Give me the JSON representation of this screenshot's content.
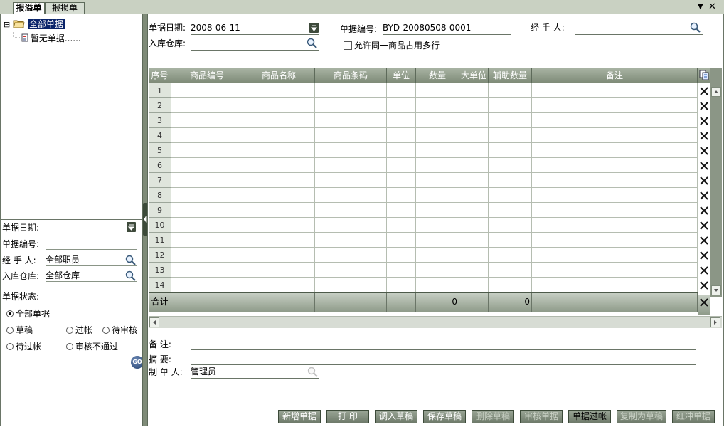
{
  "tabs": [
    {
      "label": "报溢单",
      "active": true
    },
    {
      "label": "报损单",
      "active": false
    }
  ],
  "window_controls": {
    "menu_glyph": "▼",
    "close_glyph": "✕"
  },
  "tree": {
    "collapse_glyph": "⊟",
    "root_label": "全部单据",
    "child_label": "暂无单据......"
  },
  "left_filter": {
    "date_label": "单据日期:",
    "date_value": "",
    "number_label": "单据编号:",
    "number_value": "",
    "handler_label": "经 手 人:",
    "handler_value": "全部职员",
    "warehouse_label": "入库仓库:",
    "warehouse_value": "全部仓库",
    "status_label": "单据状态:",
    "statuses": [
      {
        "label": "全部单据",
        "checked": true
      },
      {
        "label": "草稿",
        "checked": false
      },
      {
        "label": "过帐",
        "checked": false
      },
      {
        "label": "待审核",
        "checked": false
      },
      {
        "label": "待过帐",
        "checked": false
      },
      {
        "label": "审核不通过",
        "checked": false
      }
    ],
    "go_label": "GO"
  },
  "header_form": {
    "date_label": "单据日期:",
    "date_value": "2008-06-11",
    "number_label": "单据编号:",
    "number_value": "BYD-20080508-0001",
    "handler_label": "经 手 人:",
    "handler_value": "",
    "warehouse_label": "入库仓库:",
    "warehouse_value": "",
    "allow_multi_label": "允许同一商品占用多行",
    "allow_multi_checked": false
  },
  "grid": {
    "columns": [
      "序号",
      "商品编号",
      "商品名称",
      "商品条码",
      "单位",
      "数量",
      "大单位",
      "辅助数量",
      "备注"
    ],
    "row_numbers": [
      "1",
      "2",
      "3",
      "4",
      "5",
      "6",
      "7",
      "8",
      "9",
      "10",
      "11",
      "12",
      "13",
      "14"
    ],
    "sum_label": "合计",
    "sum_quantity": "0",
    "sum_aux_quantity": "0"
  },
  "footer_form": {
    "remark_label": "备  注:",
    "remark_value": "",
    "summary_label": "摘  要:",
    "summary_value": "",
    "maker_label": "制 单 人:",
    "maker_value": "管理员"
  },
  "buttons": [
    {
      "label": "新增单据",
      "enabled": true
    },
    {
      "label": "打  印",
      "enabled": true
    },
    {
      "label": "调入草稿",
      "enabled": true
    },
    {
      "label": "保存草稿",
      "enabled": true
    },
    {
      "label": "删除草稿",
      "enabled": false
    },
    {
      "label": "审核单据",
      "enabled": false
    },
    {
      "label": "单据过帐",
      "enabled": true
    },
    {
      "label": "复制为草稿",
      "enabled": false
    },
    {
      "label": "红冲单据",
      "enabled": false
    }
  ],
  "colors": {
    "toolbar_green": "#7f8b78",
    "tree_selection": "#0a246a"
  },
  "icons": [
    "folder-icon",
    "document-icon",
    "search-icon",
    "delete-row-icon",
    "copy-icon",
    "dropdown-icon",
    "go-icon"
  ]
}
